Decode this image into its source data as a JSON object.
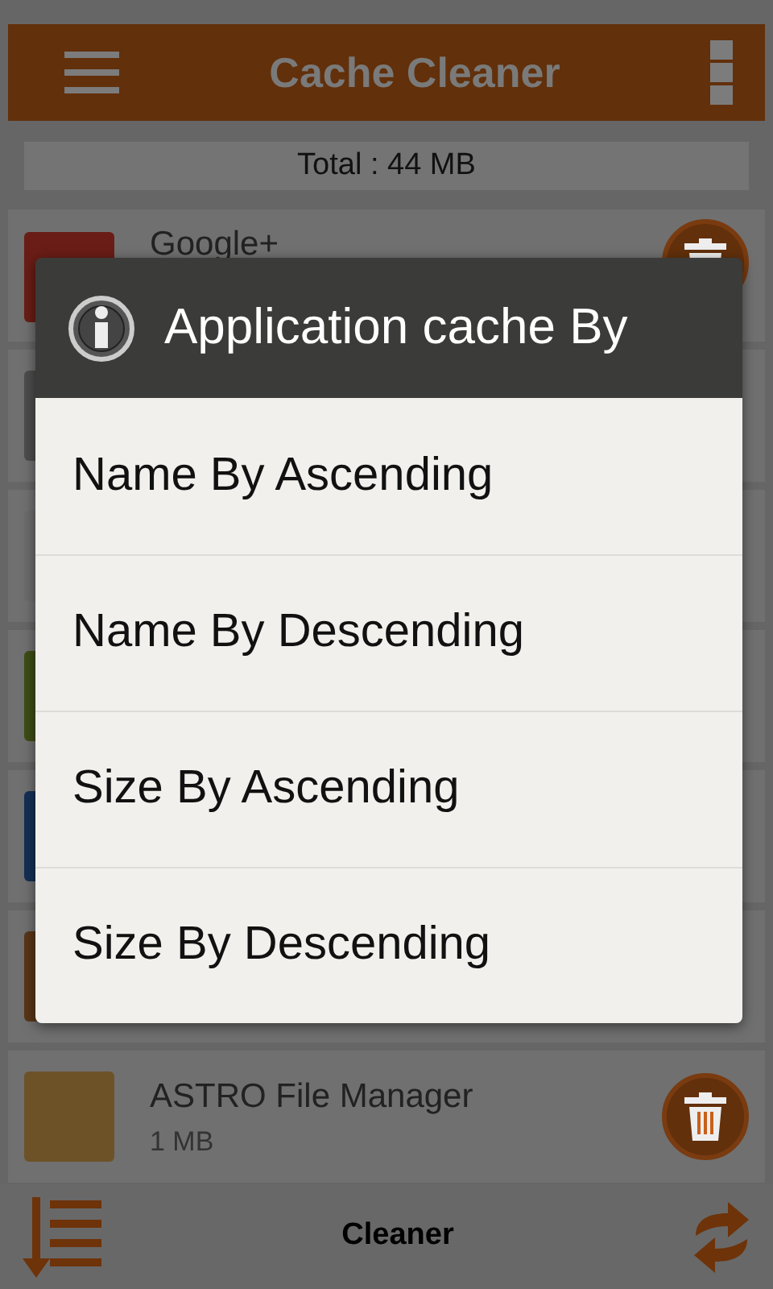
{
  "app_bar": {
    "title": "Cache Cleaner"
  },
  "summary": {
    "total": "Total : 44 MB"
  },
  "apps": [
    {
      "name": "Google+",
      "color": "#6a1d16"
    },
    {
      "color": "#4d4d4d"
    },
    {
      "color": "#6c6c6c"
    },
    {
      "color": "#3d4d15"
    },
    {
      "color": "#152f54"
    },
    {
      "color": "#583518"
    },
    {
      "name": "ASTRO File Manager",
      "size": "1 MB",
      "color": "#6d5228"
    }
  ],
  "dialog": {
    "title": "Application cache By",
    "options": [
      {
        "label": "Name By Ascending"
      },
      {
        "label": "Name By Descending"
      },
      {
        "label": "Size By Ascending"
      },
      {
        "label": "Size By Descending"
      }
    ]
  },
  "bottom_bar": {
    "label": "Cleaner"
  }
}
